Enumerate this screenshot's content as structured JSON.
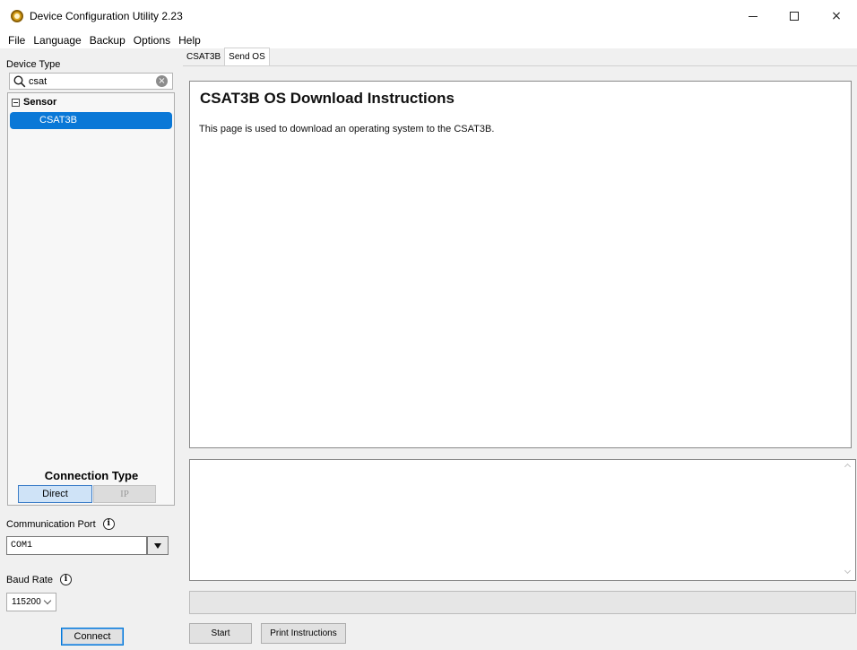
{
  "window": {
    "title": "Device Configuration Utility 2.23",
    "controls": {
      "minimize": "minimize",
      "maximize": "maximize",
      "close": "×"
    }
  },
  "menu": [
    "File",
    "Language",
    "Backup",
    "Options",
    "Help"
  ],
  "left": {
    "device_type_label": "Device Type",
    "search": {
      "value": "csat",
      "clear_symbol": "×"
    },
    "tree": {
      "group": "Sensor",
      "selected_item": "CSAT3B"
    },
    "connection": {
      "title": "Connection Type",
      "direct": "Direct",
      "ip": "IP",
      "port_label": "Communication Port",
      "port_value": "COM1",
      "baud_label": "Baud Rate",
      "baud_value": "115200",
      "info_symbol": "i",
      "connect_label": "Connect"
    }
  },
  "tabs": [
    {
      "label": "CSAT3B",
      "active": false
    },
    {
      "label": "Send OS",
      "active": true
    }
  ],
  "content": {
    "title": "CSAT3B OS Download Instructions",
    "body": "This page is used to download an operating system to the CSAT3B."
  },
  "progress": {
    "value": 0
  },
  "actions": {
    "start": "Start",
    "print": "Print Instructions"
  },
  "colors": {
    "selection": "#0a78d7",
    "direct_button": "#cfe3f7",
    "progress_fill": "#06b025"
  }
}
